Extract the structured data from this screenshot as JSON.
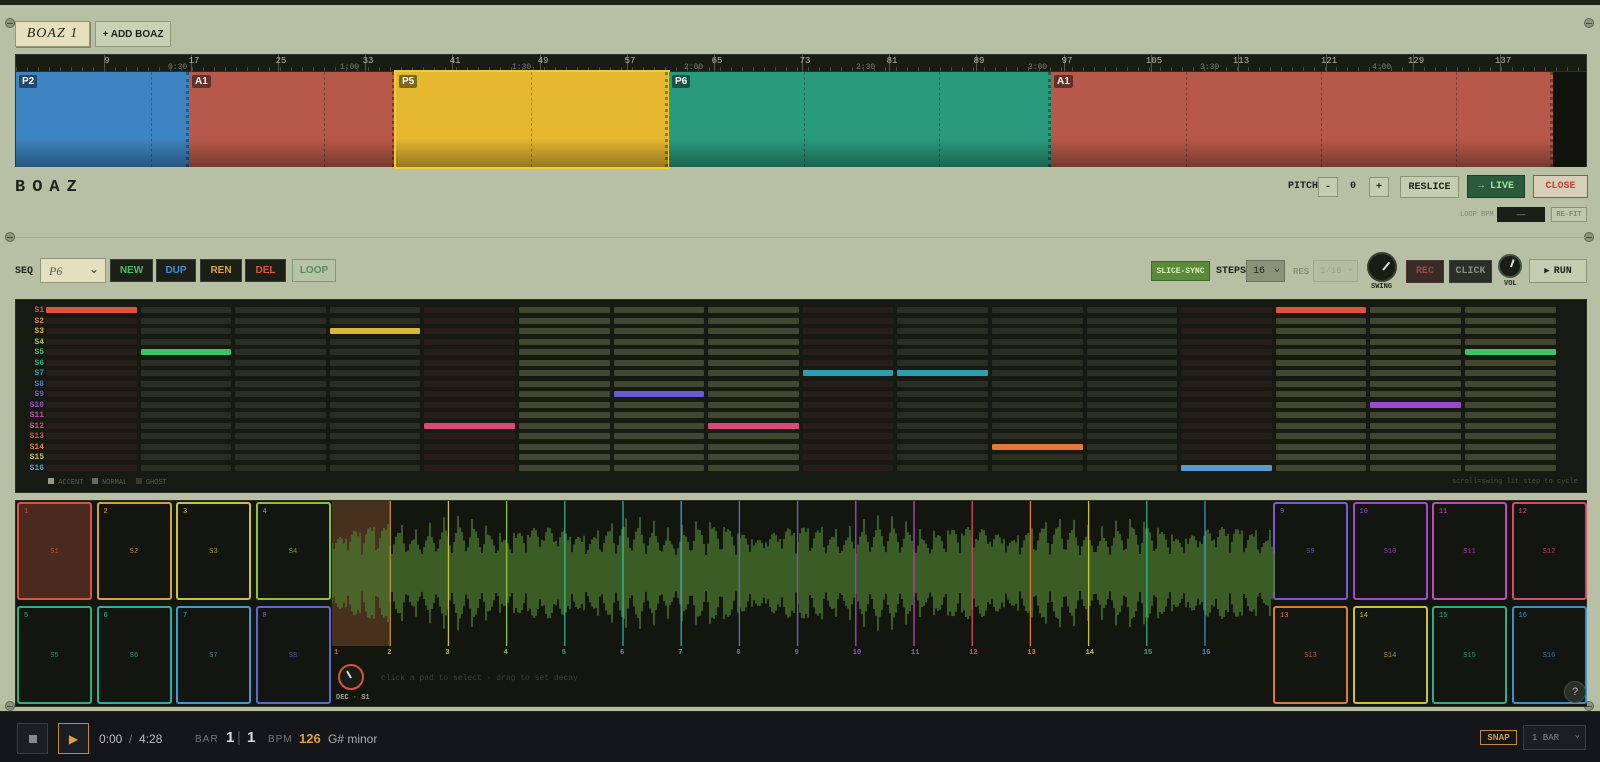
{
  "tabs": {
    "current": "BOAZ 1",
    "add": "+ ADD BOAZ"
  },
  "ruler": {
    "bars": [
      "9",
      "17",
      "25",
      "33",
      "41",
      "49",
      "57",
      "65",
      "73",
      "81",
      "89",
      "97",
      "105",
      "113",
      "121",
      "129",
      "137"
    ],
    "times": [
      "0:30",
      "1:00",
      "1:30",
      "2:00",
      "2:30",
      "3:00",
      "3:30",
      "4:00"
    ]
  },
  "arrangement": {
    "blocks": [
      {
        "label": "P2",
        "color": "#3f84c2"
      },
      {
        "label": "A1",
        "color": "#b7594a"
      },
      {
        "label": "P5",
        "color": "#e5b830"
      },
      {
        "label": "P6",
        "color": "#2a9a7c"
      },
      {
        "label": "A1",
        "color": "#b7594a"
      }
    ]
  },
  "header": {
    "title": "BOAZ",
    "pitch_label": "PITCH",
    "pitch_minus": "-",
    "pitch_value": "0",
    "pitch_plus": "+",
    "reslice": "RESLICE",
    "live": "→ LIVE",
    "close": "CLOSE",
    "loop_bpm_label": "LOOP BPM",
    "loop_bpm_value": "—",
    "refit": "RE-FIT"
  },
  "seq": {
    "label": "SEQ",
    "selected": "P6",
    "new": "NEW",
    "dup": "DUP",
    "ren": "REN",
    "del": "DEL",
    "loop": "LOOP",
    "slice_sync": "SLICE-SYNC",
    "steps_label": "STEPS",
    "steps_value": "16",
    "res_label": "RES",
    "res_value": "1/16",
    "swing_label": "SWING",
    "rec": "REC",
    "click": "CLICK",
    "vol_label": "VOL",
    "run": "RUN"
  },
  "grid": {
    "rows": [
      "S1",
      "S2",
      "S3",
      "S4",
      "S5",
      "S6",
      "S7",
      "S8",
      "S9",
      "S10",
      "S11",
      "S12",
      "S13",
      "S14",
      "S15",
      "S16"
    ],
    "row_colors": [
      "#e0533b",
      "#d9883a",
      "#d9b53a",
      "#b5c23a",
      "#3fc266",
      "#2db07e",
      "#2a9fb0",
      "#3a7fd0",
      "#6a5ad0",
      "#9a4ad0",
      "#c04ab8",
      "#d94a7a",
      "#d94a4a",
      "#e07a3a",
      "#c2c23a",
      "#5a9ad0"
    ],
    "active": [
      [
        0,
        0
      ],
      [
        1,
        4
      ],
      [
        3,
        2
      ],
      [
        4,
        11
      ],
      [
        6,
        8
      ],
      [
        7,
        11
      ],
      [
        8,
        6
      ],
      [
        9,
        6
      ],
      [
        10,
        13
      ],
      [
        12,
        15
      ],
      [
        13,
        0
      ],
      [
        14,
        9
      ],
      [
        15,
        4
      ]
    ],
    "legend": [
      "ACCENT",
      "NORMAL",
      "GHOST"
    ],
    "hint": "scroll=swing lit step to cycle"
  },
  "pads": {
    "left_top": [
      {
        "n": "1",
        "s": "S1",
        "c": "#e0533b"
      },
      {
        "n": "2",
        "s": "S2",
        "c": "#d9a03a"
      },
      {
        "n": "3",
        "s": "S3",
        "c": "#c9c23a"
      },
      {
        "n": "4",
        "s": "S4",
        "c": "#8ac23a"
      }
    ],
    "left_bot": [
      {
        "n": "5",
        "s": "S5",
        "c": "#2db07e"
      },
      {
        "n": "6",
        "s": "S6",
        "c": "#2ab0a0"
      },
      {
        "n": "7",
        "s": "S7",
        "c": "#3a9fd0"
      },
      {
        "n": "8",
        "s": "S8",
        "c": "#5a6ad0"
      }
    ],
    "right_top": [
      {
        "n": "9",
        "s": "S9",
        "c": "#7a5ad0"
      },
      {
        "n": "10",
        "s": "S10",
        "c": "#a04ad0"
      },
      {
        "n": "11",
        "s": "S11",
        "c": "#c04ab8"
      },
      {
        "n": "12",
        "s": "S12",
        "c": "#d94a6a"
      }
    ],
    "right_bot": [
      {
        "n": "13",
        "s": "S13",
        "c": "#e07a3a"
      },
      {
        "n": "14",
        "s": "S14",
        "c": "#c9c23a"
      },
      {
        "n": "15",
        "s": "S15",
        "c": "#2db07e"
      },
      {
        "n": "16",
        "s": "S16",
        "c": "#3a8fd0"
      }
    ],
    "slice_labels": [
      "1",
      "2",
      "3",
      "4",
      "5",
      "6",
      "7",
      "8",
      "9",
      "10",
      "11",
      "12",
      "13",
      "14",
      "15",
      "16"
    ],
    "decay_label": "DEC · S1",
    "hint": "click a pad to select · drag to set decay",
    "help": "?"
  },
  "transport": {
    "time_current": "0:00",
    "time_sep": "/",
    "time_total": "4:28",
    "bar_label": "BAR",
    "bar_value": "1",
    "beat_value": "1",
    "bpm_label": "BPM",
    "bpm_value": "126",
    "key": "G# minor",
    "snap": "SNAP",
    "grid_value": "1 BAR"
  }
}
